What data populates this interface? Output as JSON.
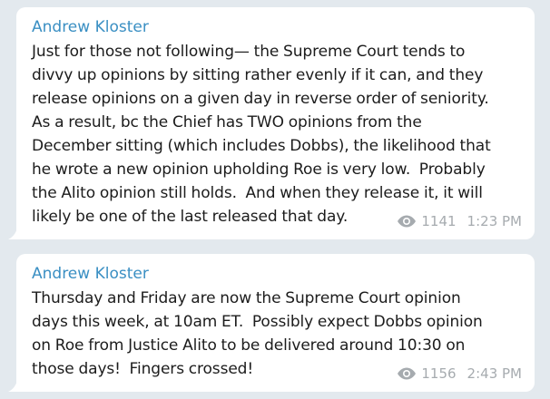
{
  "colors": {
    "background": "#e3e9ee",
    "bubble": "#ffffff",
    "author": "#3a8fc3",
    "text": "#1c1c1c",
    "meta": "#a6abaf"
  },
  "messages": [
    {
      "author": "Andrew Kloster",
      "text": "Just for those not following— the Supreme Court tends to\ndivvy up opinions by sitting rather evenly if it can, and they\nrelease opinions on a given day in reverse order of seniority.\nAs a result, bc the Chief has TWO opinions from the\nDecember sitting (which includes Dobbs), the likelihood that\nhe wrote a new opinion upholding Roe is very low.  Probably\nthe Alito opinion still holds.  And when they release it, it will\nlikely be one of the last released that day.",
      "views": "1141",
      "time": "1:23 PM",
      "icon": "eye-icon"
    },
    {
      "author": "Andrew Kloster",
      "text": "Thursday and Friday are now the Supreme Court opinion\ndays this week, at 10am ET.  Possibly expect Dobbs opinion\non Roe from Justice Alito to be delivered around 10:30 on\nthose days!  Fingers crossed!",
      "views": "1156",
      "time": "2:43 PM",
      "icon": "eye-icon"
    }
  ]
}
